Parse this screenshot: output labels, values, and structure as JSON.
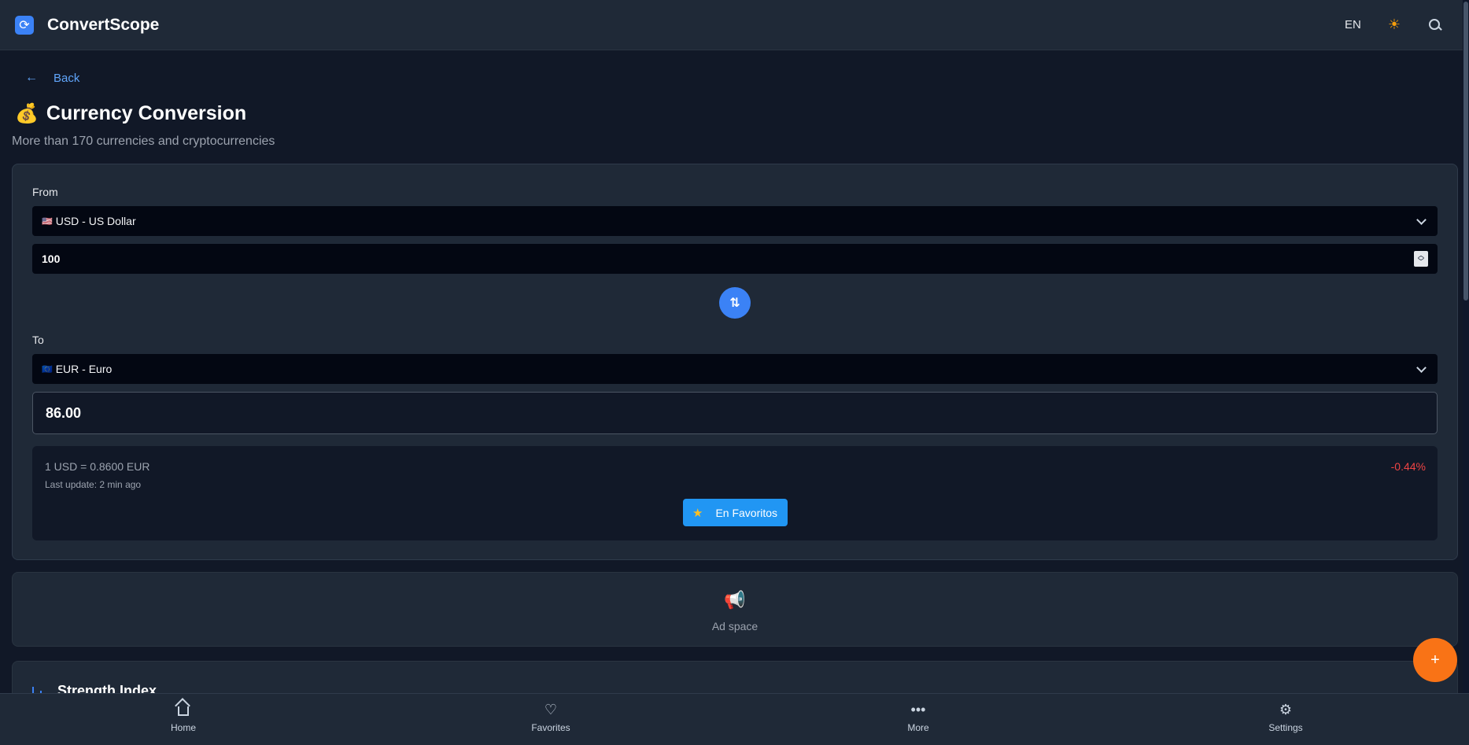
{
  "app": {
    "title": "ConvertScope",
    "logo_icon": "refresh-icon",
    "language": "EN"
  },
  "nav": {
    "back_label": "Back"
  },
  "page": {
    "title": "Currency Conversion",
    "title_emoji": "💰",
    "subtitle": "More than 170 currencies and cryptocurrencies"
  },
  "converter": {
    "from_label": "From",
    "from_flag": "🇺🇸",
    "from_currency": "USD - US Dollar",
    "amount": "100",
    "to_label": "To",
    "to_flag": "🇪🇺",
    "to_currency": "EUR - Euro",
    "result": "86.00",
    "rate_text": "1 USD = 0.8600 EUR",
    "last_update": "Last update: 2 min ago",
    "change": "-0.44%",
    "favorite_label": "En Favoritos"
  },
  "ad": {
    "label": "Ad space"
  },
  "strength": {
    "title": "Strength Index"
  },
  "bottom_nav": {
    "items": [
      {
        "label": "Home",
        "icon": "home-icon"
      },
      {
        "label": "Favorites",
        "icon": "heart-icon"
      },
      {
        "label": "More",
        "icon": "more-icon"
      },
      {
        "label": "Settings",
        "icon": "gear-icon"
      }
    ]
  },
  "colors": {
    "accent": "#3b82f6",
    "fab": "#f97316",
    "negative": "#ef4444",
    "background": "#111827",
    "surface": "#1f2937"
  }
}
